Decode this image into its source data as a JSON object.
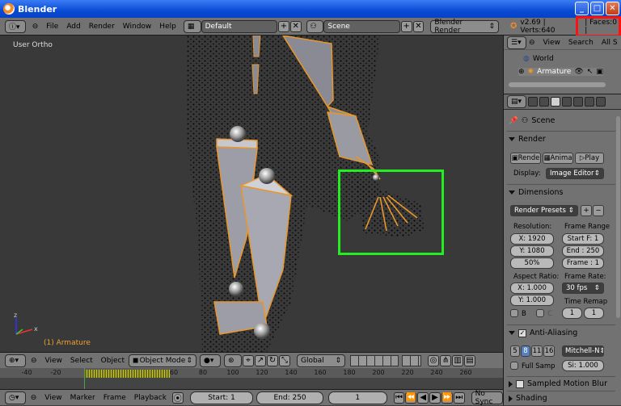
{
  "window": {
    "title": "Blender"
  },
  "info": {
    "menus": [
      "File",
      "Add",
      "Render",
      "Window",
      "Help"
    ],
    "screen_layout": "Default",
    "scene": "Scene",
    "engine": "Blender Render",
    "stats": "v2.69 | Verts:640",
    "faces": "| Faces:0 |"
  },
  "viewport": {
    "label": "User Ortho",
    "object": "(1) Armature"
  },
  "viewport_header": {
    "menus": [
      "View",
      "Select",
      "Object"
    ],
    "mode": "Object Mode",
    "orientation": "Global"
  },
  "timeline": {
    "ticks": [
      "-40",
      "-20",
      "0",
      "20",
      "40",
      "60",
      "80",
      "100",
      "120",
      "140",
      "160",
      "180",
      "200",
      "220",
      "240",
      "260"
    ],
    "menus": [
      "View",
      "Marker",
      "Frame",
      "Playback"
    ],
    "start": "Start: 1",
    "end": "End: 250",
    "current": "1",
    "sync": "No Sync"
  },
  "outliner": {
    "menus": [
      "View",
      "Search",
      "All S"
    ],
    "items": [
      "World",
      "Armature"
    ]
  },
  "properties": {
    "context": "Scene",
    "render": {
      "title": "Render",
      "render_btn": "Rende",
      "anim_btn": "Anima",
      "play_btn": "Play",
      "display_label": "Display:",
      "display_value": "Image Editor"
    },
    "dimensions": {
      "title": "Dimensions",
      "presets": "Render Presets",
      "resolution_label": "Resolution:",
      "res_x": "X: 1920",
      "res_y": "Y: 1080",
      "res_pct": "50%",
      "frame_range_label": "Frame Range",
      "start_f": "Start F: 1",
      "end_f": "End : 250",
      "frame_step": "Frame : 1",
      "aspect_label": "Aspect Ratio:",
      "asp_x": "X: 1.000",
      "asp_y": "Y: 1.000",
      "frame_rate_label": "Frame Rate:",
      "fps": "30 fps",
      "time_remap_label": "Time Remap",
      "remap_old": "1",
      "remap_new": "1",
      "b_label": "B",
      "c_label": "C"
    },
    "antialiasing": {
      "title": "Anti-Aliasing",
      "samples": [
        "5",
        "8",
        "11",
        "16"
      ],
      "selected": "8",
      "filter": "Mitchell-N",
      "full_sample": "Full Samp",
      "size": "Si: 1.000"
    },
    "collapsed": [
      "Sampled Motion Blur",
      "Shading"
    ]
  }
}
